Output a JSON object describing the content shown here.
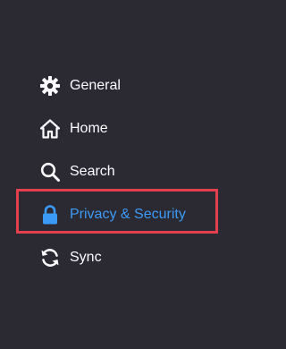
{
  "sidebar": {
    "items": [
      {
        "label": "General",
        "icon": "gear-icon"
      },
      {
        "label": "Home",
        "icon": "home-icon"
      },
      {
        "label": "Search",
        "icon": "search-icon"
      },
      {
        "label": "Privacy & Security",
        "icon": "lock-icon",
        "selected": true
      },
      {
        "label": "Sync",
        "icon": "sync-icon"
      }
    ]
  },
  "colors": {
    "background": "#2b2a33",
    "text": "#fbfbfe",
    "selected": "#3c9af7",
    "highlight_border": "#e2404c"
  }
}
